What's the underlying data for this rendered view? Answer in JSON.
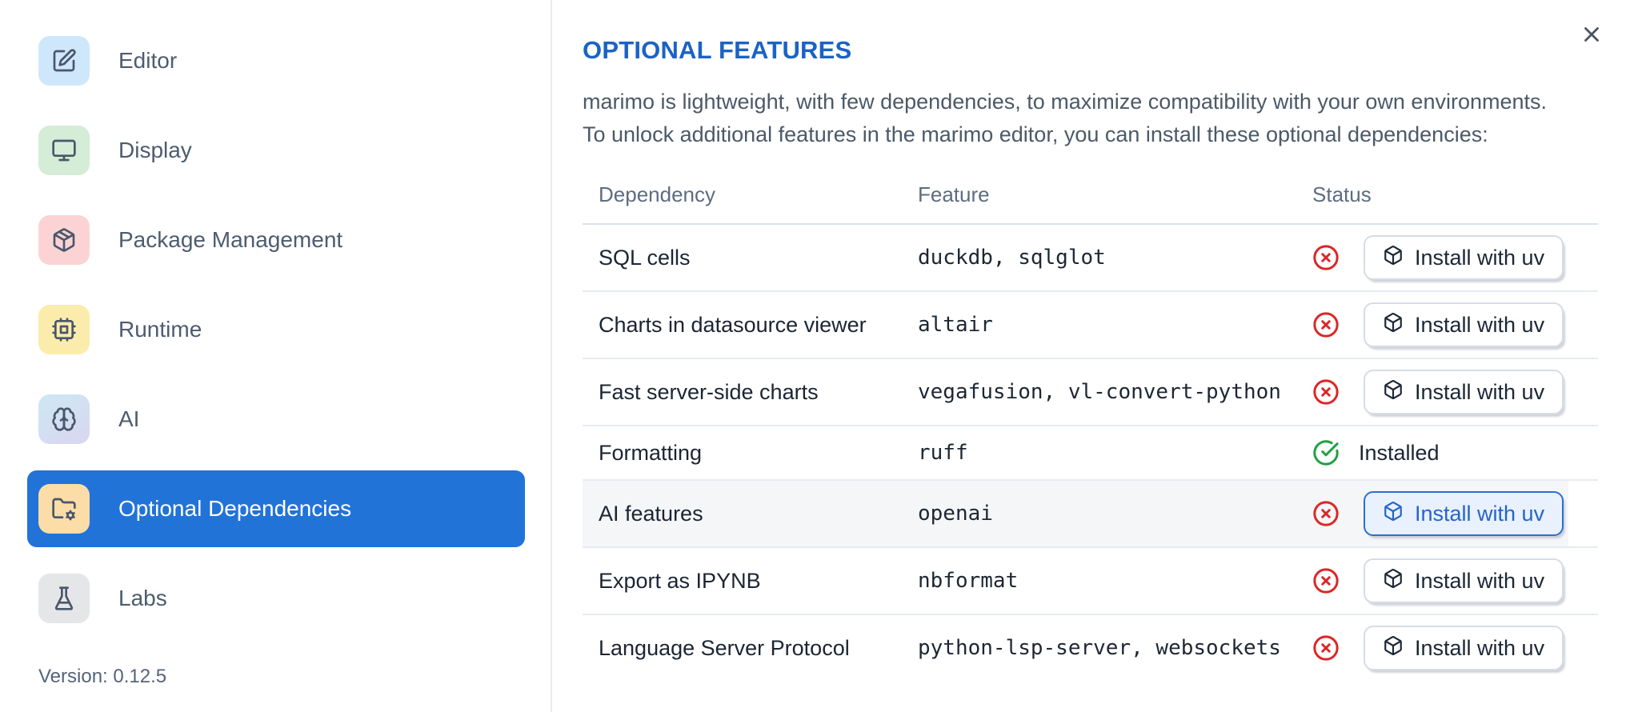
{
  "sidebar": {
    "items": [
      {
        "label": "Editor",
        "icon": "editor-pen-icon",
        "tile_color": "#cfe7fb",
        "selected": false
      },
      {
        "label": "Display",
        "icon": "monitor-icon",
        "tile_color": "#d5ecd6",
        "selected": false
      },
      {
        "label": "Package Management",
        "icon": "package-icon",
        "tile_color": "#fbd3d4",
        "selected": false
      },
      {
        "label": "Runtime",
        "icon": "cpu-icon",
        "tile_color": "#fcecab",
        "selected": false
      },
      {
        "label": "AI",
        "icon": "brain-icon",
        "tile_color": "linear-gradient(150deg,#cde8f4 0%,#d9d6f0 100%)",
        "selected": false
      },
      {
        "label": "Optional Dependencies",
        "icon": "folder-gear-icon",
        "tile_color": "#fcdca7",
        "selected": true
      },
      {
        "label": "Labs",
        "icon": "flask-icon",
        "tile_color": "#e5e6e8",
        "selected": false
      }
    ],
    "version_label": "Version: 0.12.5"
  },
  "panel": {
    "title": "OPTIONAL FEATURES",
    "description_line1": "marimo is lightweight, with few dependencies, to maximize compatibility with your own environments.",
    "description_line2": "To unlock additional features in the marimo editor, you can install these optional dependencies:",
    "close_icon": "x-icon"
  },
  "table": {
    "columns": [
      "Dependency",
      "Feature",
      "Status"
    ],
    "install_button_label": "Install with uv",
    "installed_label": "Installed",
    "rows": [
      {
        "dependency": "SQL cells",
        "feature": "duckdb, sqlglot",
        "status": "missing",
        "highlighted": false
      },
      {
        "dependency": "Charts in datasource viewer",
        "feature": "altair",
        "status": "missing",
        "highlighted": false
      },
      {
        "dependency": "Fast server-side charts",
        "feature": "vegafusion, vl-convert-python",
        "status": "missing",
        "highlighted": false
      },
      {
        "dependency": "Formatting",
        "feature": "ruff",
        "status": "installed",
        "highlighted": false
      },
      {
        "dependency": "AI features",
        "feature": "openai",
        "status": "missing",
        "highlighted": true
      },
      {
        "dependency": "Export as IPYNB",
        "feature": "nbformat",
        "status": "missing",
        "highlighted": false
      },
      {
        "dependency": "Language Server Protocol",
        "feature": "python-lsp-server, websockets",
        "status": "missing",
        "highlighted": false
      }
    ]
  },
  "colors": {
    "accent_blue": "#2173d8",
    "title_blue": "#1a63c5",
    "status_red": "#dc2626",
    "status_green": "#1fa043",
    "focus_button_border": "#2b6fd2",
    "focus_button_bg": "#e8f1fd"
  }
}
